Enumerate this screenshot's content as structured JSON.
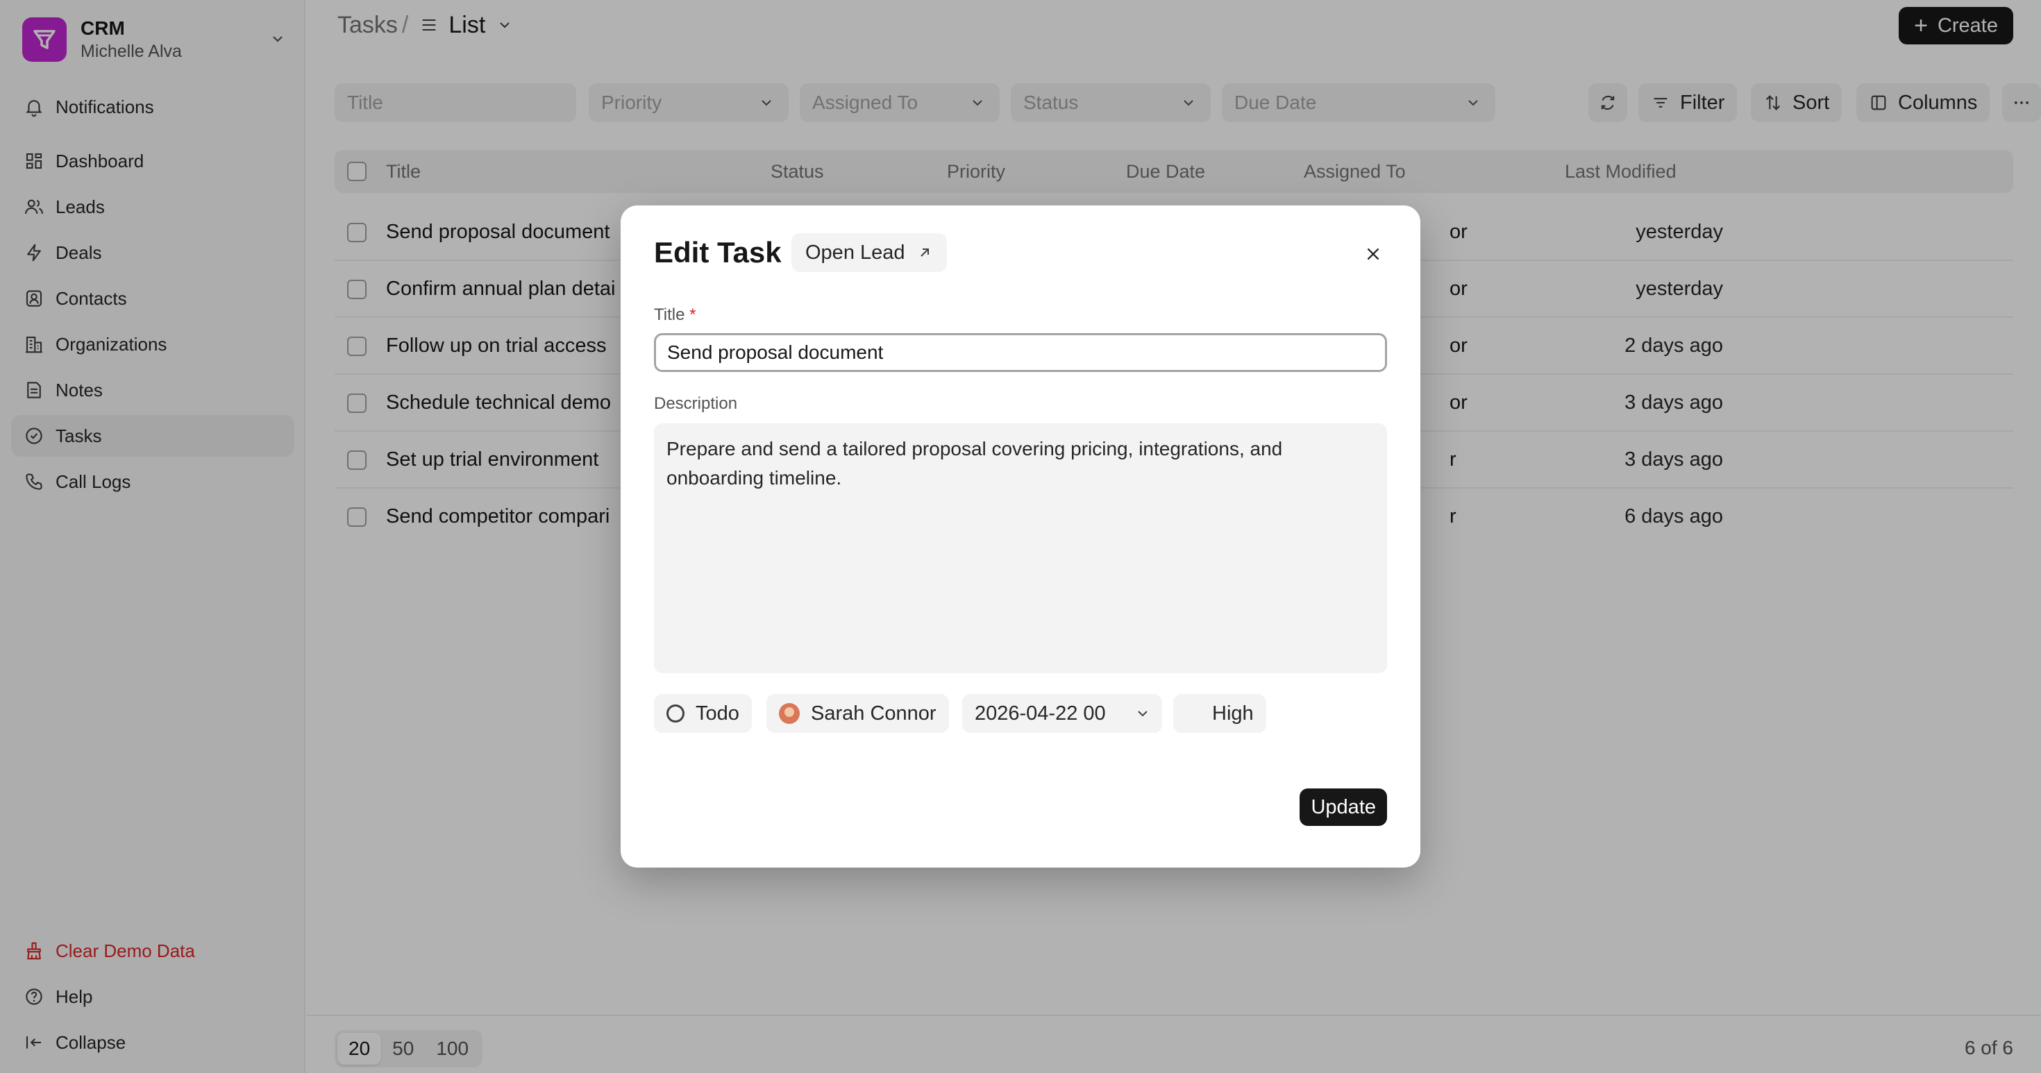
{
  "sidebar": {
    "app_name": "CRM",
    "user_name": "Michelle Alva",
    "nav": [
      {
        "label": "Notifications",
        "icon": "bell-icon"
      },
      {
        "label": "Dashboard",
        "icon": "dashboard-icon"
      },
      {
        "label": "Leads",
        "icon": "users-icon"
      },
      {
        "label": "Deals",
        "icon": "lightning-icon"
      },
      {
        "label": "Contacts",
        "icon": "contact-icon"
      },
      {
        "label": "Organizations",
        "icon": "building-icon"
      },
      {
        "label": "Notes",
        "icon": "note-icon"
      },
      {
        "label": "Tasks",
        "icon": "check-circle-icon"
      },
      {
        "label": "Call Logs",
        "icon": "phone-icon"
      }
    ],
    "active_nav": "Tasks",
    "bottom": [
      {
        "label": "Clear Demo Data",
        "icon": "broom-icon"
      },
      {
        "label": "Help",
        "icon": "help-icon"
      },
      {
        "label": "Collapse",
        "icon": "collapse-icon"
      }
    ]
  },
  "header": {
    "breadcrumb_root": "Tasks",
    "breadcrumb_sep": "/",
    "view_label": "List",
    "create_label": "Create"
  },
  "filters": {
    "title_placeholder": "Title",
    "priority_placeholder": "Priority",
    "assigned_placeholder": "Assigned To",
    "status_placeholder": "Status",
    "due_placeholder": "Due Date",
    "filter_label": "Filter",
    "sort_label": "Sort",
    "columns_label": "Columns"
  },
  "table": {
    "columns": [
      "Title",
      "Status",
      "Priority",
      "Due Date",
      "Assigned To",
      "Last Modified"
    ],
    "rows": [
      {
        "title": "Send proposal document",
        "assigned_partial": "or",
        "modified": "yesterday"
      },
      {
        "title": "Confirm annual plan detai",
        "assigned_partial": "or",
        "modified": "yesterday"
      },
      {
        "title": "Follow up on trial access",
        "assigned_partial": "or",
        "modified": "2 days ago"
      },
      {
        "title": "Schedule technical demo",
        "assigned_partial": "or",
        "modified": "3 days ago"
      },
      {
        "title": "Set up trial environment",
        "assigned_partial": "r",
        "modified": "3 days ago"
      },
      {
        "title": "Send competitor compari",
        "assigned_partial": "r",
        "modified": "6 days ago"
      }
    ]
  },
  "footer": {
    "page_sizes": [
      "20",
      "50",
      "100"
    ],
    "selected_page_size": "20",
    "count_text": "6 of 6"
  },
  "modal": {
    "title": "Edit Task",
    "open_lead_label": "Open Lead",
    "title_label": "Title",
    "required_mark": "*",
    "title_value": "Send proposal document",
    "description_label": "Description",
    "description_value": "Prepare and send a tailored proposal covering pricing, integrations, and onboarding timeline.",
    "status": "Todo",
    "assignee": "Sarah Connor",
    "due_date": "2026-04-22 00",
    "priority": "High",
    "update_label": "Update"
  },
  "colors": {
    "brand": "#c026d3",
    "danger": "#dc2626",
    "primary_button": "#171717"
  }
}
